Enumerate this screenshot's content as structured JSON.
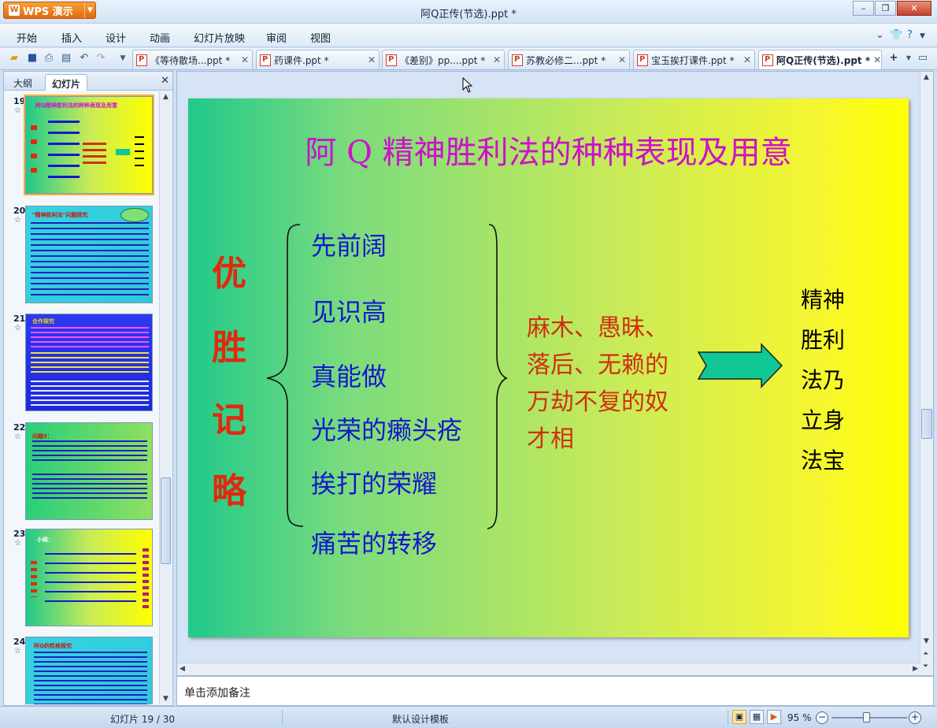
{
  "app": {
    "name": "WPS 演示",
    "window_title": "阿Q正传(节选).ppt *"
  },
  "menu": [
    "开始",
    "插入",
    "设计",
    "动画",
    "幻灯片放映",
    "审阅",
    "视图"
  ],
  "doc_tabs": [
    {
      "label": "《等待散场...ppt *",
      "active": false
    },
    {
      "label": "药课件.ppt *",
      "active": false
    },
    {
      "label": "《差别》pp....ppt *",
      "active": false
    },
    {
      "label": "苏教必修二...ppt *",
      "active": false
    },
    {
      "label": "宝玉挨打课件.ppt *",
      "active": false
    },
    {
      "label": "阿Q正传(节选).ppt *",
      "active": true
    }
  ],
  "panel": {
    "tabs": [
      "大纲",
      "幻灯片"
    ],
    "active_tab": "幻灯片",
    "thumbnails": [
      {
        "num": "19",
        "star": "☆",
        "selected": true,
        "title": "阿Q精神胜利法的种种表现及用意"
      },
      {
        "num": "20",
        "star": "☆",
        "selected": false,
        "title": "\"精神胜利法\"问题探究"
      },
      {
        "num": "21",
        "star": "☆",
        "selected": false,
        "title": "合作探究"
      },
      {
        "num": "22",
        "star": "☆",
        "selected": false,
        "title": "问题5："
      },
      {
        "num": "23",
        "star": "☆",
        "selected": false,
        "title": "小结："
      },
      {
        "num": "24",
        "star": "☆",
        "selected": false,
        "title": "阿Q的性格探究"
      }
    ]
  },
  "slide": {
    "title": "阿 Q 精神胜利法的种种表现及用意",
    "vertical_chars": [
      "优",
      "胜",
      "记",
      "略"
    ],
    "items": [
      "先前阔",
      "见识高",
      "真能做",
      "光荣的癞头疮",
      "挨打的荣耀",
      "痛苦的转移"
    ],
    "desc_lines": [
      "麻木、愚昧、",
      "落后、无赖的",
      "万劫不复的奴",
      "才相"
    ],
    "right_lines": [
      "精神",
      "胜利",
      "法乃",
      "立身",
      "法宝"
    ],
    "colors": {
      "title": "#cc11cc",
      "vertical": "#e02a0e",
      "items": "#1418cc",
      "desc": "#d03010",
      "arrow": "#10c896"
    }
  },
  "notes_placeholder": "单击添加备注",
  "status": {
    "slide_info": "幻灯片 19 / 30",
    "template": "默认设计模板",
    "zoom": "95 %"
  },
  "icons": [
    "new-icon",
    "save-icon",
    "print-icon",
    "preview-icon",
    "undo-icon",
    "redo-icon",
    "minimize-icon",
    "restore-icon",
    "close-icon",
    "help-icon",
    "skin-icon"
  ]
}
